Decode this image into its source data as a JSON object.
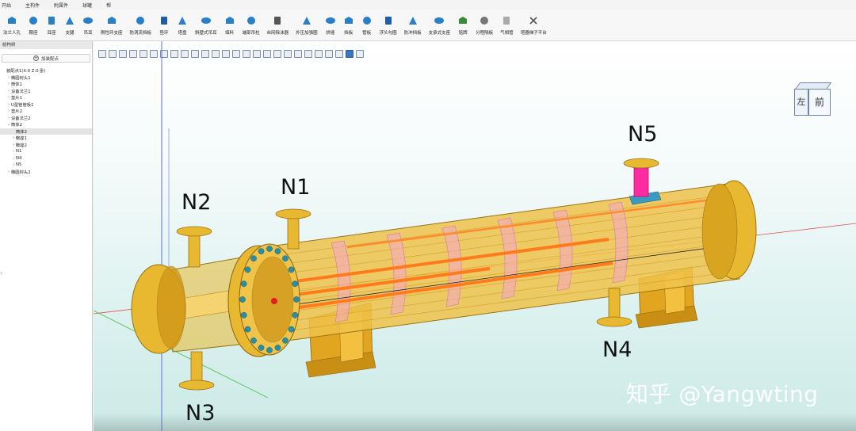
{
  "menu": {
    "items": [
      "开始",
      "主构件",
      "附属件",
      "球罐",
      "帮"
    ]
  },
  "ribbon": {
    "tools": [
      {
        "label": "法兰人孔",
        "icon": "flange-manhole-icon",
        "color": "#2a7fc9"
      },
      {
        "label": "鞍座",
        "icon": "saddle-icon",
        "color": "#2a7fc9"
      },
      {
        "label": "耳座",
        "icon": "lug-icon",
        "color": "#2a7fc9"
      },
      {
        "label": "支腿",
        "icon": "leg-icon",
        "color": "#2a7fc9"
      },
      {
        "label": "吊耳",
        "icon": "lifting-lug-icon",
        "color": "#2a7fc9"
      },
      {
        "label": "刚性环支座",
        "icon": "ring-support-icon",
        "color": "#2a7fc9"
      },
      {
        "label": "防涡流挡板",
        "icon": "vortex-baffle-icon",
        "color": "#2a7fc9"
      },
      {
        "label": "垫环",
        "icon": "pad-ring-icon",
        "color": "#1d5fa8"
      },
      {
        "label": "塔盘",
        "icon": "tray-icon",
        "color": "#2a7fc9"
      },
      {
        "label": "斜壁式吊耳",
        "icon": "slant-lug-icon",
        "color": "#2a7fc9"
      },
      {
        "label": "填料",
        "icon": "packing-icon",
        "color": "#2a7fc9"
      },
      {
        "label": "端部吊柱",
        "icon": "davit-icon",
        "color": "#2a7fc9"
      },
      {
        "label": "丝网除沫器",
        "icon": "demister-icon",
        "color": "#555555"
      },
      {
        "label": "外压加强圈",
        "icon": "stiffener-ring-icon",
        "color": "#2a7fc9"
      },
      {
        "label": "烘墙",
        "icon": "wall-icon",
        "color": "#2a7fc9"
      },
      {
        "label": "挡板",
        "icon": "baffle-icon",
        "color": "#2a7fc9"
      },
      {
        "label": "管板",
        "icon": "tube-sheet-icon",
        "color": "#2a7fc9"
      },
      {
        "label": "浮头勾圈",
        "icon": "floating-head-icon",
        "color": "#1d5fa8"
      },
      {
        "label": "防冲挡板",
        "icon": "impingement-plate-icon",
        "color": "#2a7fc9"
      },
      {
        "label": "支承式支座",
        "icon": "bearing-support-icon",
        "color": "#2a7fc9"
      },
      {
        "label": "铭牌",
        "icon": "nameplate-icon",
        "color": "#3a8a3a"
      },
      {
        "label": "分程隔板",
        "icon": "pass-partition-icon",
        "color": "#777777"
      },
      {
        "label": "气相管",
        "icon": "vapor-pipe-icon",
        "color": "#aaaaaa"
      },
      {
        "label": "塔器梯子平台",
        "icon": "close-icon",
        "color": "#555555"
      }
    ]
  },
  "left_panel": {
    "title": "结构树",
    "add_button": "加装配点",
    "tree": [
      {
        "label": "装配点1(X:0 Z:0 卧)",
        "indent": 0,
        "arrow": "",
        "selected": false
      },
      {
        "label": "椭圆封头1",
        "indent": 1,
        "arrow": "›",
        "selected": false
      },
      {
        "label": "筒体1",
        "indent": 1,
        "arrow": "›",
        "selected": false
      },
      {
        "label": "设备法兰1",
        "indent": 1,
        "arrow": "›",
        "selected": false
      },
      {
        "label": "垫片1",
        "indent": 1,
        "arrow": "›",
        "selected": false
      },
      {
        "label": "U型管管板1",
        "indent": 1,
        "arrow": "›",
        "selected": false
      },
      {
        "label": "垫片2",
        "indent": 1,
        "arrow": "›",
        "selected": false
      },
      {
        "label": "设备法兰2",
        "indent": 1,
        "arrow": "›",
        "selected": false
      },
      {
        "label": "筒体2",
        "indent": 1,
        "arrow": "⌄",
        "selected": false
      },
      {
        "label": "筒体2",
        "indent": 2,
        "arrow": "",
        "selected": true
      },
      {
        "label": "鞍座1",
        "indent": 2,
        "arrow": "›",
        "selected": false
      },
      {
        "label": "鞍座2",
        "indent": 2,
        "arrow": "›",
        "selected": false
      },
      {
        "label": "N1",
        "indent": 2,
        "arrow": "›",
        "selected": false
      },
      {
        "label": "N4",
        "indent": 2,
        "arrow": "›",
        "selected": false
      },
      {
        "label": "N5",
        "indent": 2,
        "arrow": "›",
        "selected": false
      },
      {
        "label": "椭圆封头2",
        "indent": 1,
        "arrow": "›",
        "selected": false
      }
    ],
    "side_tab": "‹"
  },
  "viewport": {
    "nozzles": {
      "n1": "N1",
      "n2": "N2",
      "n3": "N3",
      "n4": "N4",
      "n5": "N5"
    },
    "view_cube": {
      "left_face": "左",
      "front_face": "前"
    },
    "watermark": "知乎 @Yangwting",
    "colors": {
      "shell": "#e8b830",
      "shell_dark": "#b98a10",
      "flange_bolts": "#2a8fa6",
      "baffle_tint": "#f4a6c8",
      "tie_rod": "#ff7a1a",
      "nozzle_pink": "#ff2aa0",
      "saddle": "#e6a820"
    }
  }
}
